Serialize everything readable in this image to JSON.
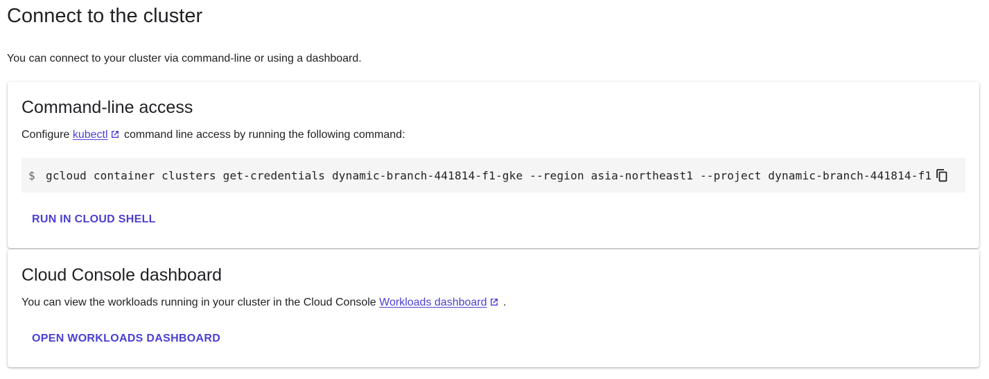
{
  "page": {
    "title": "Connect to the cluster",
    "intro": "You can connect to your cluster via command-line or using a dashboard."
  },
  "cli_card": {
    "title": "Command-line access",
    "text_before": "Configure ",
    "link_label": "kubectl",
    "text_after": " command line access by running the following command:",
    "prompt": "$",
    "command": "gcloud container clusters get-credentials dynamic-branch-441814-f1-gke --region asia-northeast1 --project dynamic-branch-441814-f1",
    "copy_icon": "copy-icon",
    "button_label": "RUN IN CLOUD SHELL"
  },
  "dashboard_card": {
    "title": "Cloud Console dashboard",
    "text_before": "You can view the workloads running in your cluster in the Cloud Console ",
    "link_label": "Workloads dashboard",
    "text_after": " .",
    "button_label": "OPEN WORKLOADS DASHBOARD"
  },
  "colors": {
    "accent": "#4b3fd3",
    "text": "#202124",
    "code_bg": "#f5f5f5"
  }
}
